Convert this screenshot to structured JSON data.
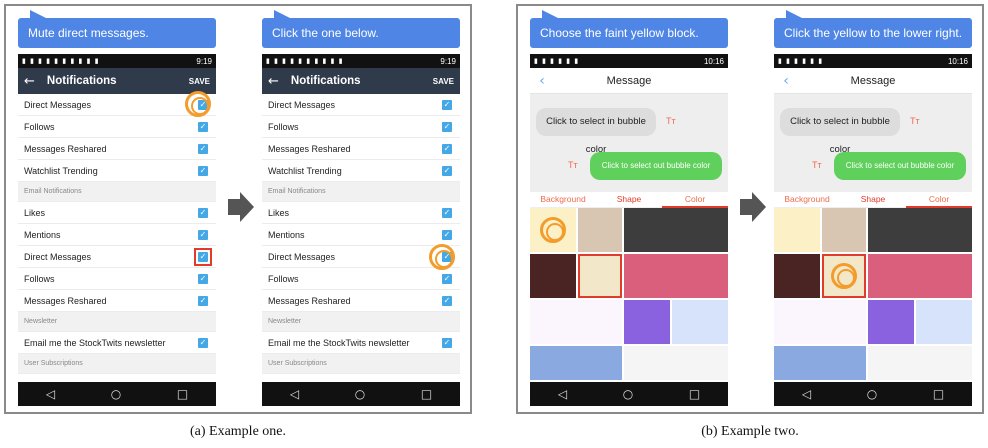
{
  "figure": {
    "captions": [
      "(a) Example one.",
      "(b) Example two."
    ]
  },
  "example_one": {
    "steps": [
      {
        "instruction": "Mute direct messages."
      },
      {
        "instruction": "Click the one below."
      }
    ],
    "status_time": "9:19",
    "appbar": {
      "back": "←",
      "title": "Notifications",
      "save": "SAVE"
    },
    "rows": [
      {
        "label": "Direct Messages",
        "type": "toggle"
      },
      {
        "label": "Follows",
        "type": "toggle"
      },
      {
        "label": "Messages Reshared",
        "type": "toggle"
      },
      {
        "label": "Watchlist Trending",
        "type": "toggle"
      },
      {
        "label": "Email Notifications",
        "type": "section"
      },
      {
        "label": "Likes",
        "type": "toggle"
      },
      {
        "label": "Mentions",
        "type": "toggle"
      },
      {
        "label": "Direct Messages",
        "type": "toggle"
      },
      {
        "label": "Follows",
        "type": "toggle"
      },
      {
        "label": "Messages Reshared",
        "type": "toggle"
      },
      {
        "label": "Newsletter",
        "type": "section"
      },
      {
        "label": "Email me the StockTwits newsletter",
        "type": "toggle"
      },
      {
        "label": "User Subscriptions",
        "type": "section"
      }
    ],
    "check_glyph": "✓"
  },
  "example_two": {
    "steps": [
      {
        "instruction": "Choose the faint yellow block."
      },
      {
        "instruction": "Click the yellow to the lower right."
      }
    ],
    "status_time": "10:16",
    "appbar": {
      "back": "‹",
      "title": "Message"
    },
    "in_bubble": "Click to select in bubble color",
    "out_bubble": "Click to select out bubble color",
    "tt_glyph": "Tт",
    "tabs": [
      "Background",
      "Shape",
      "Color"
    ],
    "colors": {
      "cream": "#fbf0c6",
      "tan": "#d9c6b2",
      "dark_gray": "#3d3d3d",
      "maroon": "#4a2323",
      "faint_yellow": "#f2e8c9",
      "pink": "#d95f7d",
      "lavender_white": "#fbf6fd",
      "purple": "#8a62e0",
      "light_blue": "#d7e3fb",
      "cornflower": "#8aa9e0",
      "near_white": "#f5f5f5"
    }
  },
  "nav": {
    "back": "◁",
    "home": "○",
    "recent": "□"
  }
}
